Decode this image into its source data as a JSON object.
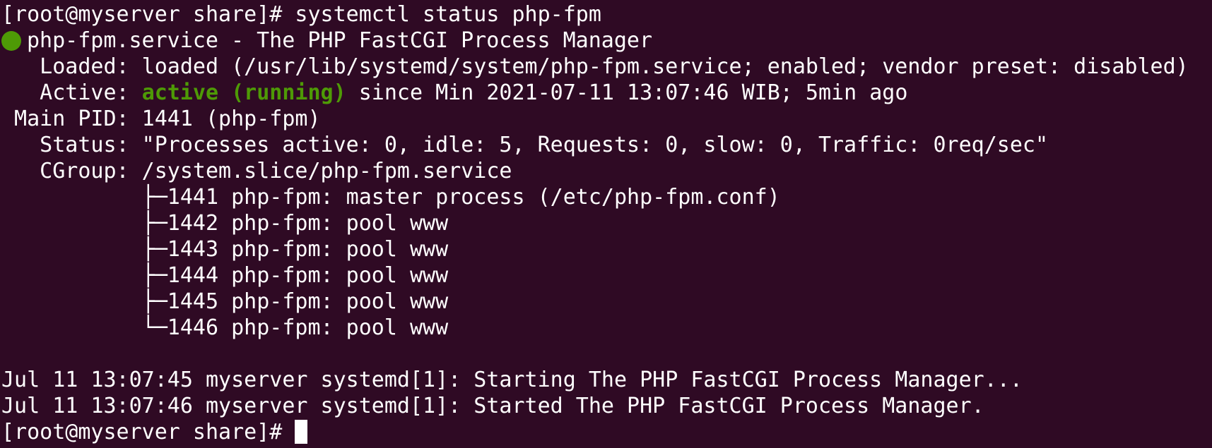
{
  "prompt": "[root@myserver share]# ",
  "command": "systemctl status php-fpm",
  "service_header": "php-fpm.service - The PHP FastCGI Process Manager",
  "loaded_line": "   Loaded: loaded (/usr/lib/systemd/system/php-fpm.service; enabled; vendor preset: disabled)",
  "active_label": "   Active: ",
  "active_state": "active (running)",
  "active_rest": " since Min 2021-07-11 13:07:46 WIB; 5min ago",
  "main_pid_line": " Main PID: 1441 (php-fpm)",
  "status_line": "   Status: \"Processes active: 0, idle: 5, Requests: 0, slow: 0, Traffic: 0req/sec\"",
  "cgroup_line": "   CGroup: /system.slice/php-fpm.service",
  "processes": [
    "           ├─1441 php-fpm: master process (/etc/php-fpm.conf)",
    "           ├─1442 php-fpm: pool www",
    "           ├─1443 php-fpm: pool www",
    "           ├─1444 php-fpm: pool www",
    "           ├─1445 php-fpm: pool www",
    "           └─1446 php-fpm: pool www"
  ],
  "log_lines": [
    "Jul 11 13:07:45 myserver systemd[1]: Starting The PHP FastCGI Process Manager...",
    "Jul 11 13:07:46 myserver systemd[1]: Started The PHP FastCGI Process Manager."
  ],
  "final_prompt": "[root@myserver share]# ",
  "colors": {
    "background": "#2f0a24",
    "foreground": "#ffffff",
    "status_green": "#4e9a06"
  },
  "icons": {
    "status_dot": "status-dot-icon"
  }
}
